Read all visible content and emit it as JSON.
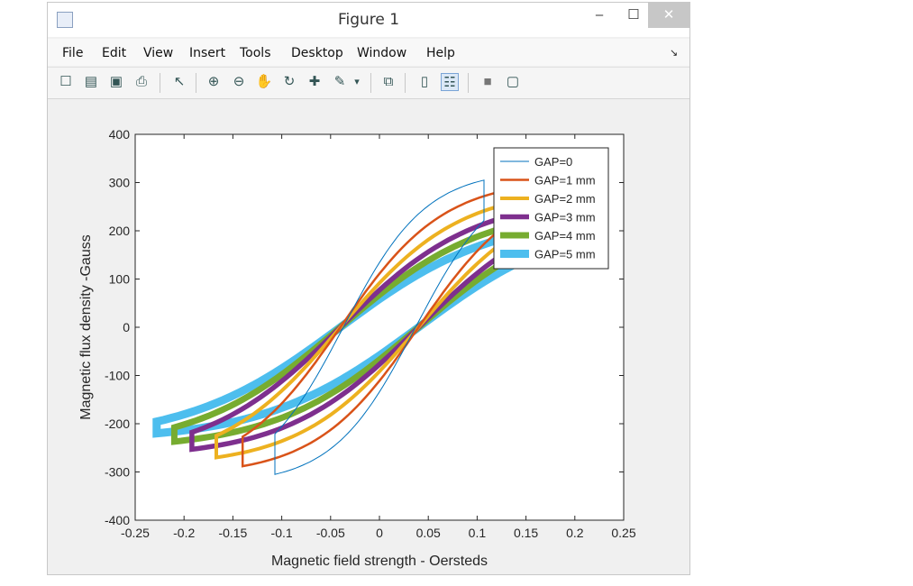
{
  "window": {
    "title": "Figure 1",
    "minimize": "–",
    "maximize": "☐",
    "close": "✕"
  },
  "menu": [
    "File",
    "Edit",
    "View",
    "Insert",
    "Tools",
    "Desktop",
    "Window",
    "Help"
  ],
  "menu_more": "↘",
  "toolbar": [
    {
      "name": "new-figure-icon",
      "glyph": "☐"
    },
    {
      "name": "open-file-icon",
      "glyph": "▤"
    },
    {
      "name": "save-icon",
      "glyph": "▣"
    },
    {
      "name": "print-icon",
      "glyph": "⎙"
    },
    {
      "name": "pointer-icon",
      "glyph": "↖"
    },
    {
      "name": "zoom-in-icon",
      "glyph": "⊕"
    },
    {
      "name": "zoom-out-icon",
      "glyph": "⊖"
    },
    {
      "name": "pan-icon",
      "glyph": "✋"
    },
    {
      "name": "rotate-3d-icon",
      "glyph": "↻"
    },
    {
      "name": "data-cursor-icon",
      "glyph": "✚"
    },
    {
      "name": "brush-icon",
      "glyph": "✎"
    },
    {
      "name": "brush-dropdown-icon",
      "glyph": "▾"
    },
    {
      "name": "link-plot-icon",
      "glyph": "⧉"
    },
    {
      "name": "colorbar-icon",
      "glyph": "▯"
    },
    {
      "name": "legend-icon",
      "glyph": "☷"
    },
    {
      "name": "hide-plot-tools-icon",
      "glyph": "■"
    },
    {
      "name": "show-plot-tools-icon",
      "glyph": "▢"
    }
  ],
  "colors": {
    "GAP0": "#0072BD",
    "GAP1": "#D95319",
    "GAP2": "#EDB120",
    "GAP3": "#7E2F8E",
    "GAP4": "#77AC30",
    "GAP5": "#4DBEEE"
  },
  "chart_data": {
    "type": "line",
    "xlabel": "Magnetic field strength - Oersteds",
    "ylabel": "Magnetic flux density -Gauss",
    "xlim": [
      -0.25,
      0.25
    ],
    "ylim": [
      -400,
      400
    ],
    "xticks": [
      -0.25,
      -0.2,
      -0.15,
      -0.1,
      -0.05,
      0,
      0.05,
      0.1,
      0.15,
      0.2,
      0.25
    ],
    "yticks": [
      400,
      300,
      200,
      100,
      0,
      -100,
      -200,
      -300,
      -400
    ],
    "legend_position": "top-right",
    "grid": false,
    "series": [
      {
        "name": "GAP=0",
        "color": "#0072BD",
        "hmax": 0.107,
        "bmax": 305,
        "coercive": 0.037
      },
      {
        "name": "GAP=1 mm",
        "color": "#D95319",
        "hmax": 0.14,
        "bmax": 288,
        "coercive": 0.04
      },
      {
        "name": "GAP=2 mm",
        "color": "#EDB120",
        "hmax": 0.167,
        "bmax": 270,
        "coercive": 0.04
      },
      {
        "name": "GAP=3 mm",
        "color": "#7E2F8E",
        "hmax": 0.192,
        "bmax": 253,
        "coercive": 0.04
      },
      {
        "name": "GAP=4 mm",
        "color": "#77AC30",
        "hmax": 0.21,
        "bmax": 237,
        "coercive": 0.04
      },
      {
        "name": "GAP=5 mm",
        "color": "#4DBEEE",
        "hmax": 0.228,
        "bmax": 220,
        "coercive": 0.04
      }
    ]
  }
}
